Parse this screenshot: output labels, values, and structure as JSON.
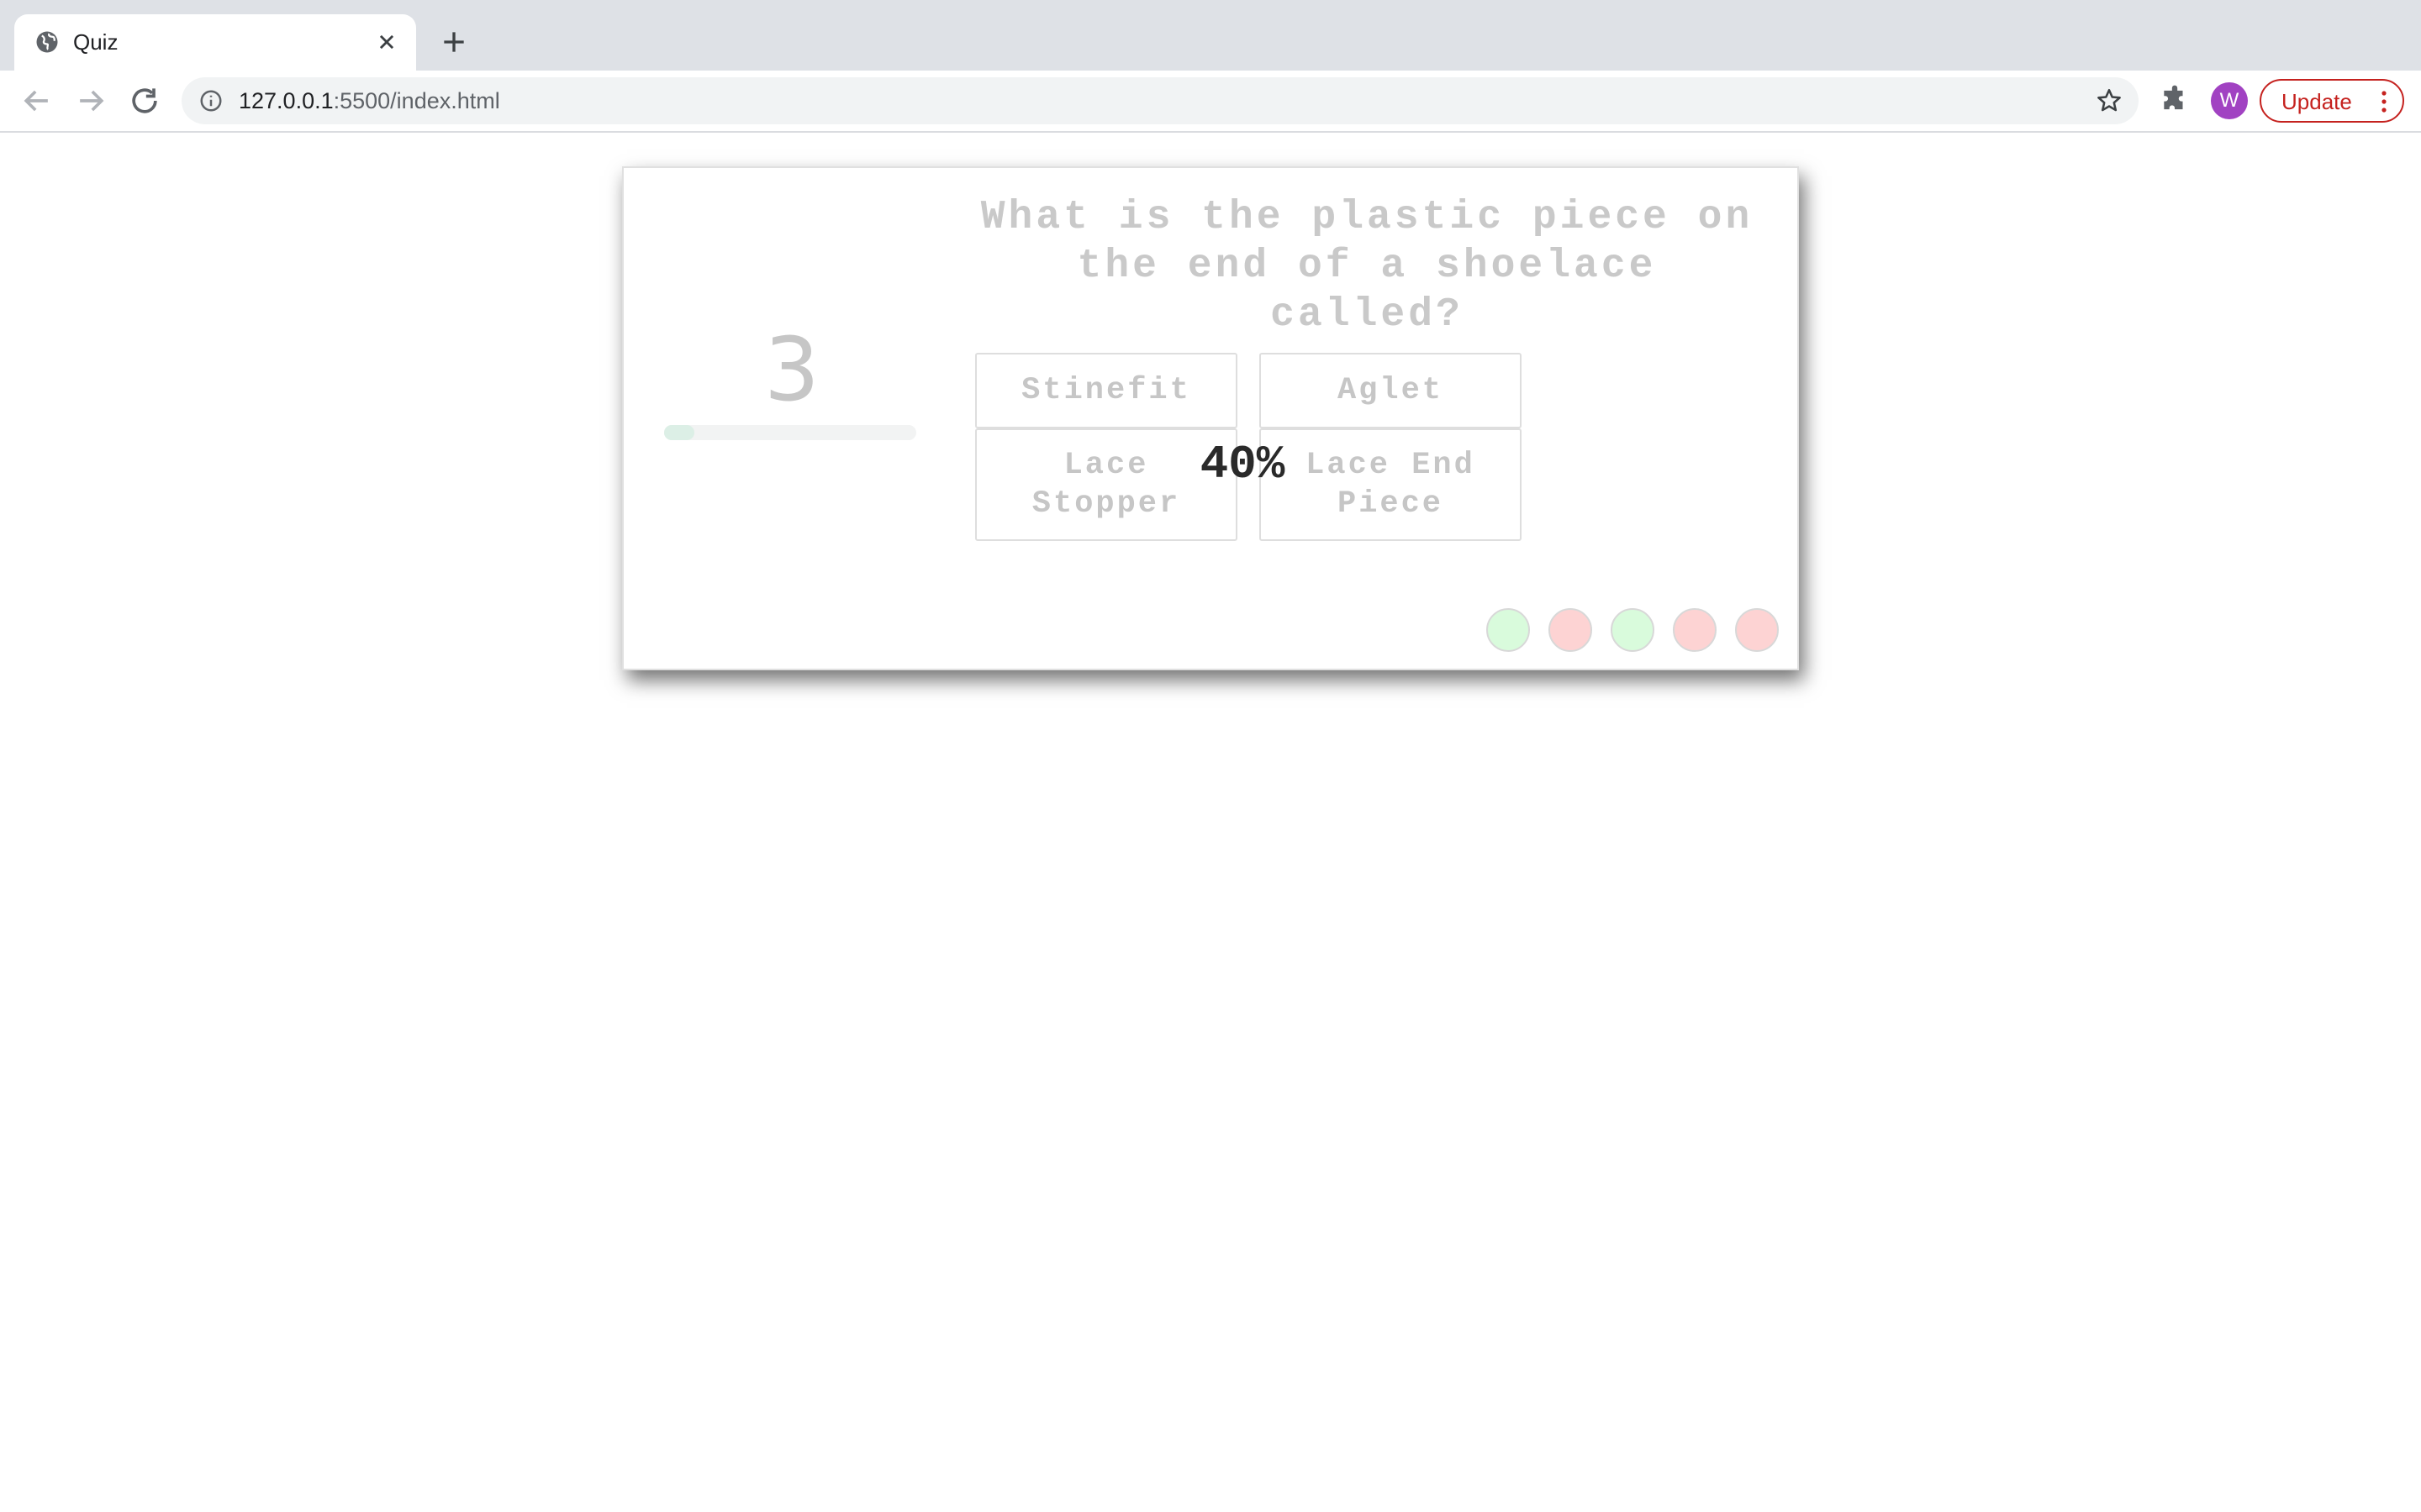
{
  "browser": {
    "tab_title": "Quiz",
    "url_host": "127.0.0.1",
    "url_rest": ":5500/index.html",
    "avatar_initial": "W",
    "update_label": "Update",
    "icons": {
      "favicon": "globe-icon",
      "tab_close": "close-icon",
      "new_tab": "plus-icon",
      "back": "arrow-left-icon",
      "forward": "arrow-right-icon",
      "reload": "reload-icon",
      "site_info": "info-icon",
      "bookmark": "star-icon",
      "extensions": "puzzle-icon",
      "menu": "kebab-icon"
    }
  },
  "quiz": {
    "timer_value": "3",
    "timer_progress": 0.12,
    "question": "What is the plastic piece on the end of a shoelace called?",
    "answers": [
      {
        "label": "Stinefit"
      },
      {
        "label": "Aglet"
      },
      {
        "label": "Lace Stopper"
      },
      {
        "label": "Lace End Piece"
      }
    ],
    "score_percent": "40%",
    "results": [
      {
        "status": "correct",
        "color": "#d9fbdc"
      },
      {
        "status": "wrong",
        "color": "#fdd3d3"
      },
      {
        "status": "correct",
        "color": "#d9fbdc"
      },
      {
        "status": "wrong",
        "color": "#fdd3d3"
      },
      {
        "status": "wrong",
        "color": "#fdd3d3"
      }
    ]
  },
  "colors": {
    "correct": "#d9fbdc",
    "wrong": "#fdd3d3",
    "update_accent": "#c5221f",
    "avatar": "#a142c2"
  }
}
